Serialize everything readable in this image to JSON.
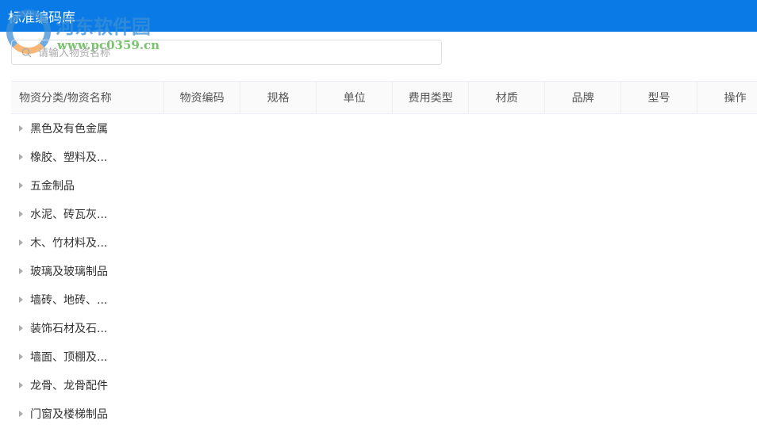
{
  "header": {
    "title": "标准编码库"
  },
  "watermark": {
    "name": "河东软件园",
    "url": "www.pc0359.cn"
  },
  "search": {
    "placeholder": "请输入物资名称",
    "value": ""
  },
  "table": {
    "columns": [
      "物资分类/物资名称",
      "物资编码",
      "规格",
      "单位",
      "费用类型",
      "材质",
      "品牌",
      "型号",
      "操作"
    ],
    "rows": [
      "黑色及有色金属",
      "橡胶、塑料及...",
      "五金制品",
      "水泥、砖瓦灰...",
      "木、竹材料及...",
      "玻璃及玻璃制品",
      "墙砖、地砖、...",
      "装饰石材及石...",
      "墙面、顶棚及...",
      "龙骨、龙骨配件",
      "门窗及楼梯制品"
    ]
  },
  "colors": {
    "accent": "#0a7be6"
  }
}
